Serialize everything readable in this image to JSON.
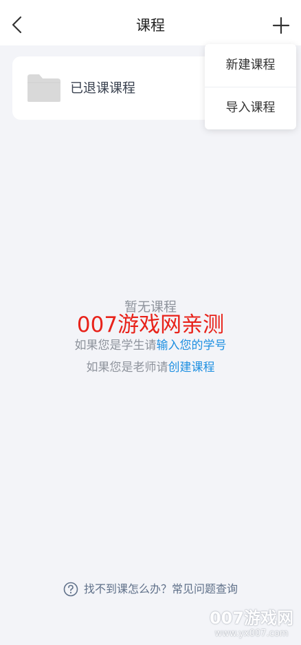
{
  "header": {
    "title": "课程",
    "back_icon": "chevron-left-icon",
    "add_icon": "plus-icon"
  },
  "folder": {
    "label": "已退课课程",
    "icon": "folder-icon",
    "icon_color": "#d9d9d9"
  },
  "menu": {
    "items": [
      {
        "label": "新建课程"
      },
      {
        "label": "导入课程"
      }
    ]
  },
  "empty": {
    "title": "暂无课程",
    "student_prefix": "如果您是学生请",
    "student_link": "输入您的学号",
    "teacher_prefix": "如果您是老师请",
    "teacher_link": "创建课程",
    "link_color": "#1d8fe1"
  },
  "watermark": {
    "red_text": "007游戏网亲测",
    "brand": "007游戏网",
    "url": "www.yx007.com"
  },
  "help": {
    "icon": "question-circle-icon",
    "text": "找不到课怎么办？常见问题查询"
  },
  "colors": {
    "background": "#f3f4f8",
    "card": "#ffffff",
    "watermark_red": "#e8221a"
  }
}
